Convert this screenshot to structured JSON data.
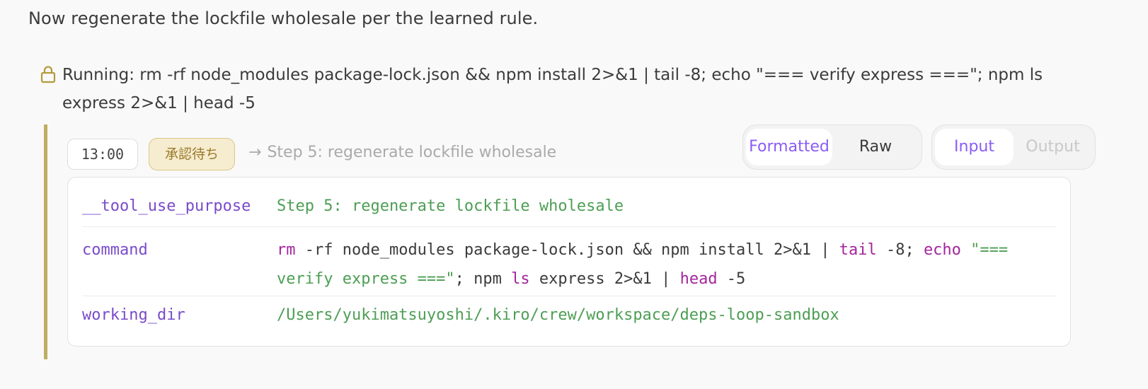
{
  "message": {
    "text": "Now regenerate the lockfile wholesale per the learned rule."
  },
  "running": {
    "icon": "lock-icon",
    "text": "Running: rm -rf node_modules package-lock.json && npm install 2>&1 | tail -8; echo \"=== verify express ===\"; npm ls express 2>&1 | head -5"
  },
  "card": {
    "accent_color": "#bfae62",
    "timestamp": "13:00",
    "badge": "承認待ち",
    "step_hint": "Step 5: regenerate lockfile wholesale",
    "format_toggle": {
      "formatted": "Formatted",
      "raw": "Raw",
      "selected": "Formatted"
    },
    "io_toggle": {
      "input": "Input",
      "output": "Output",
      "selected": "Input"
    },
    "fields": {
      "purpose": {
        "key": "__tool_use_purpose",
        "value": "Step 5: regenerate lockfile wholesale"
      },
      "command": {
        "key": "command",
        "tokens": [
          {
            "text": "rm",
            "kind": "cmd"
          },
          {
            "text": " -rf node_modules package-lock.json && npm install 2>&1 | ",
            "kind": "plain"
          },
          {
            "text": "tail",
            "kind": "cmd"
          },
          {
            "text": " -8; ",
            "kind": "plain"
          },
          {
            "text": "echo",
            "kind": "cmd"
          },
          {
            "text": " ",
            "kind": "plain"
          },
          {
            "text": "\"=== verify express ===\"",
            "kind": "str"
          },
          {
            "text": "; npm ",
            "kind": "plain"
          },
          {
            "text": "ls",
            "kind": "cmd"
          },
          {
            "text": " express 2>&1 | ",
            "kind": "plain"
          },
          {
            "text": "head",
            "kind": "cmd"
          },
          {
            "text": " -5",
            "kind": "plain"
          }
        ]
      },
      "working_dir": {
        "key": "working_dir",
        "value": "/Users/yukimatsuyoshi/.kiro/crew/workspace/deps-loop-sandbox"
      }
    }
  }
}
